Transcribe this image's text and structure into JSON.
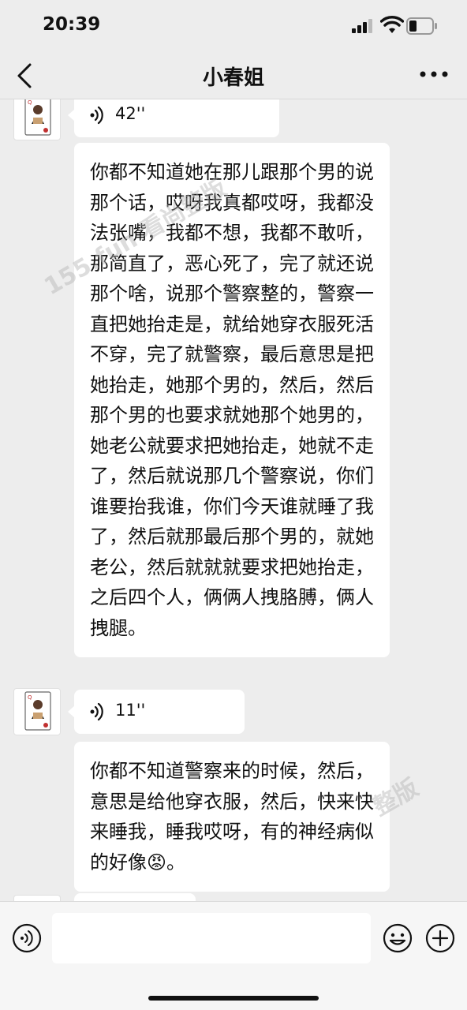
{
  "status_bar": {
    "time": "20:39"
  },
  "header": {
    "title": "小春姐"
  },
  "messages": [
    {
      "type": "voice",
      "duration": "42''"
    },
    {
      "type": "text",
      "content": "你都不知道她在那儿跟那个男的说那个话，哎呀我真都哎呀，我都没法张嘴，我都不想，我都不敢听，那简直了，恶心死了，完了就还说那个啥，说那个警察整的，警察一直把她抬走是，就给她穿衣服死活不穿，完了就警察，最后意思是把她抬走，她那个男的，然后，然后那个男的也要求就她那个她男的，她老公就要求把她抬走，她就不走了，然后就说那几个警察说，你们谁要抬我谁，你们今天谁就睡了我了，然后就那最后那个男的，就她老公，然后就就就要求把她抬走，之后四个人，俩俩人拽胳膊，俩人拽腿。"
    },
    {
      "type": "voice",
      "duration": "11''"
    },
    {
      "type": "text",
      "content": "你都不知道警察来的时候，然后，意思是给他穿衣服，然后，快来快来睡我，睡我哎呀，有的神经病似的好像😡。"
    }
  ],
  "watermarks": [
    "155.fun 看尚整版",
    "整版"
  ],
  "icons": {
    "back": "chevron-left-icon",
    "more": "more-dots-icon",
    "voice_input": "voice-input-icon",
    "emoji": "emoji-icon",
    "plus": "plus-icon"
  },
  "colors": {
    "background": "#ededed",
    "bubble": "#ffffff",
    "input_bar": "#f6f6f6"
  }
}
